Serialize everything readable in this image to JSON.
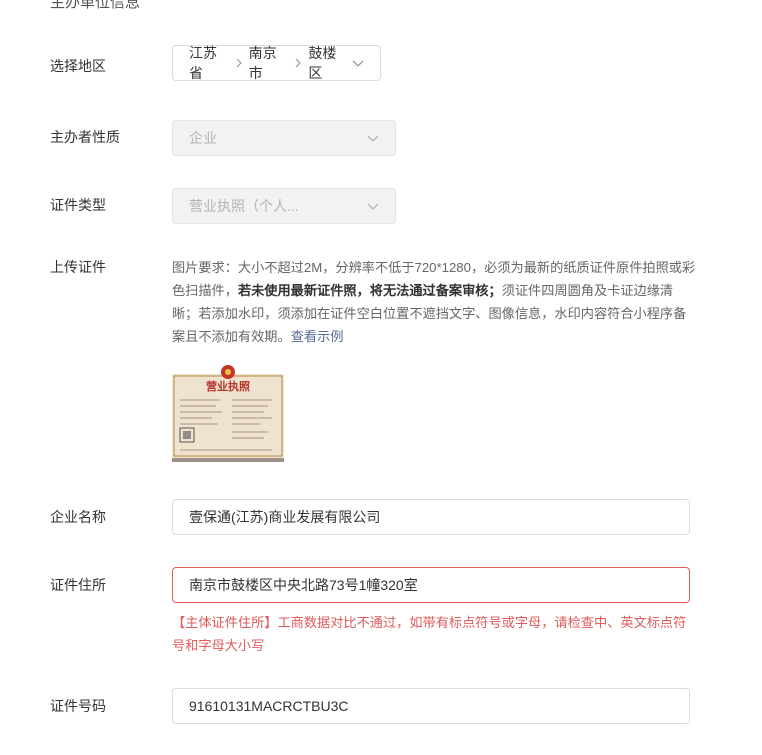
{
  "section_title": "主办单位信息",
  "region": {
    "label": "选择地区",
    "province": "江苏省",
    "city": "南京市",
    "district": "鼓楼区"
  },
  "organizer_nature": {
    "label": "主办者性质",
    "value": "企业"
  },
  "certificate_type": {
    "label": "证件类型",
    "value": "营业执照（个人..."
  },
  "upload": {
    "label": "上传证件",
    "hint_part1": "图片要求：大小不超过2M，分辨率不低于720*1280，必须为最新的纸质证件原件拍照或彩色扫描件，",
    "hint_bold": "若未使用最新证件照，将无法通过备案审核；",
    "hint_part2": "须证件四周圆角及卡证边缘清晰；若添加水印，须添加在证件空白位置不遮挡文字、图像信息，水印内容符合小程序备案且不添加有效期。",
    "example_link": "查看示例",
    "license_title": "营业执照"
  },
  "company_name": {
    "label": "企业名称",
    "value": "壹保通(江苏)商业发展有限公司"
  },
  "certificate_address": {
    "label": "证件住所",
    "value": "南京市鼓楼区中央北路73号1幢320室",
    "error": "【主体证件住所】工商数据对比不通过，如带有标点符号或字母，请检查中、英文标点符号和字母大小写"
  },
  "certificate_number": {
    "label": "证件号码",
    "value": "91610131MACRCTBU3C"
  },
  "colors": {
    "error": "#e15b5b",
    "link": "#576b95",
    "disabled_bg": "#f2f2f2"
  }
}
